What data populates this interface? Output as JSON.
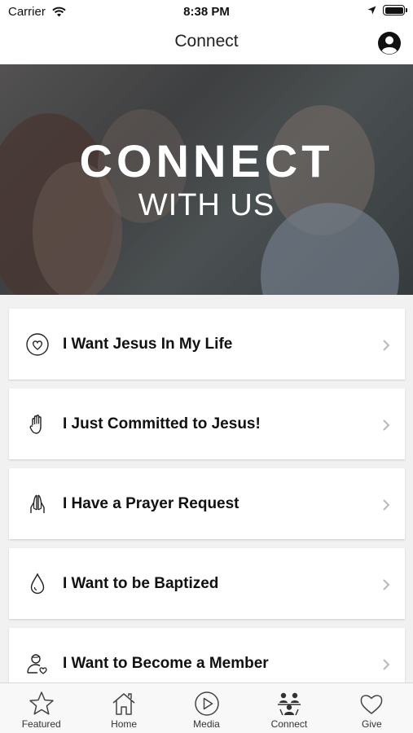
{
  "status_bar": {
    "carrier": "Carrier",
    "time": "8:38 PM"
  },
  "nav": {
    "title": "Connect"
  },
  "hero": {
    "line1": "CONNECT",
    "line2": "WITH US"
  },
  "menu": [
    {
      "label": "I Want Jesus In My Life",
      "icon": "heart-circle-icon"
    },
    {
      "label": "I Just Committed to Jesus!",
      "icon": "raised-hand-icon"
    },
    {
      "label": "I Have a Prayer Request",
      "icon": "praying-hands-icon"
    },
    {
      "label": "I Want to be Baptized",
      "icon": "water-drop-icon"
    },
    {
      "label": "I Want to Become a Member",
      "icon": "person-heart-icon"
    }
  ],
  "tabs": [
    {
      "label": "Featured",
      "icon": "star-icon"
    },
    {
      "label": "Home",
      "icon": "home-icon"
    },
    {
      "label": "Media",
      "icon": "play-icon"
    },
    {
      "label": "Connect",
      "icon": "people-icon",
      "active": true
    },
    {
      "label": "Give",
      "icon": "heart-icon"
    }
  ]
}
